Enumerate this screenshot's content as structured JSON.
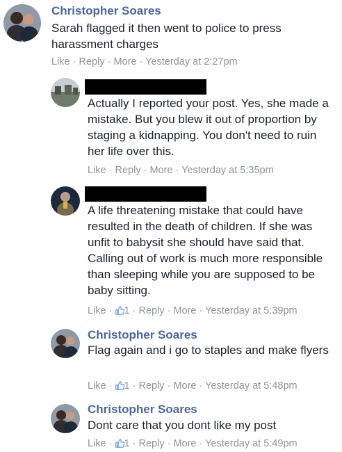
{
  "comments": [
    {
      "author": "Christopher Soares",
      "text": "Sarah flagged it then went to police to press harassment charges",
      "like": "Like",
      "reply": "Reply",
      "more": "More",
      "time": "Yesterday at 2:27pm"
    },
    {
      "author": "",
      "text": "Actually I reported your post. Yes, she made a mistake. But you blew it out of proportion by staging a kidnapping. You don't need to ruin her life over this.",
      "like": "Like",
      "reply": "Reply",
      "more": "More",
      "time": "Yesterday at 5:35pm"
    },
    {
      "author": "",
      "text": "A life threatening mistake that could have resulted in the death of children. If she was unfit to babysit she should have said that. Calling out of work is much more responsible than sleeping while you are supposed to be baby sitting.",
      "like": "Like",
      "like_count": "1",
      "reply": "Reply",
      "more": "More",
      "time": "Yesterday at 5:39pm"
    },
    {
      "author": "Christopher Soares",
      "text": "Flag again and i go to staples and make flyers",
      "like": "Like",
      "like_count": "1",
      "reply": "Reply",
      "more": "More",
      "time": "Yesterday at 5:48pm"
    },
    {
      "author": "Christopher Soares",
      "text": "Dont care that you dont like my post",
      "like": "Like",
      "like_count": "1",
      "reply": "Reply",
      "more": "More",
      "time": "Yesterday at 5:49pm"
    }
  ],
  "icons": {
    "like": "thumbs-up-icon"
  },
  "colors": {
    "name": "#4b67a1",
    "meta": "#90949c",
    "text": "#1d2129"
  }
}
